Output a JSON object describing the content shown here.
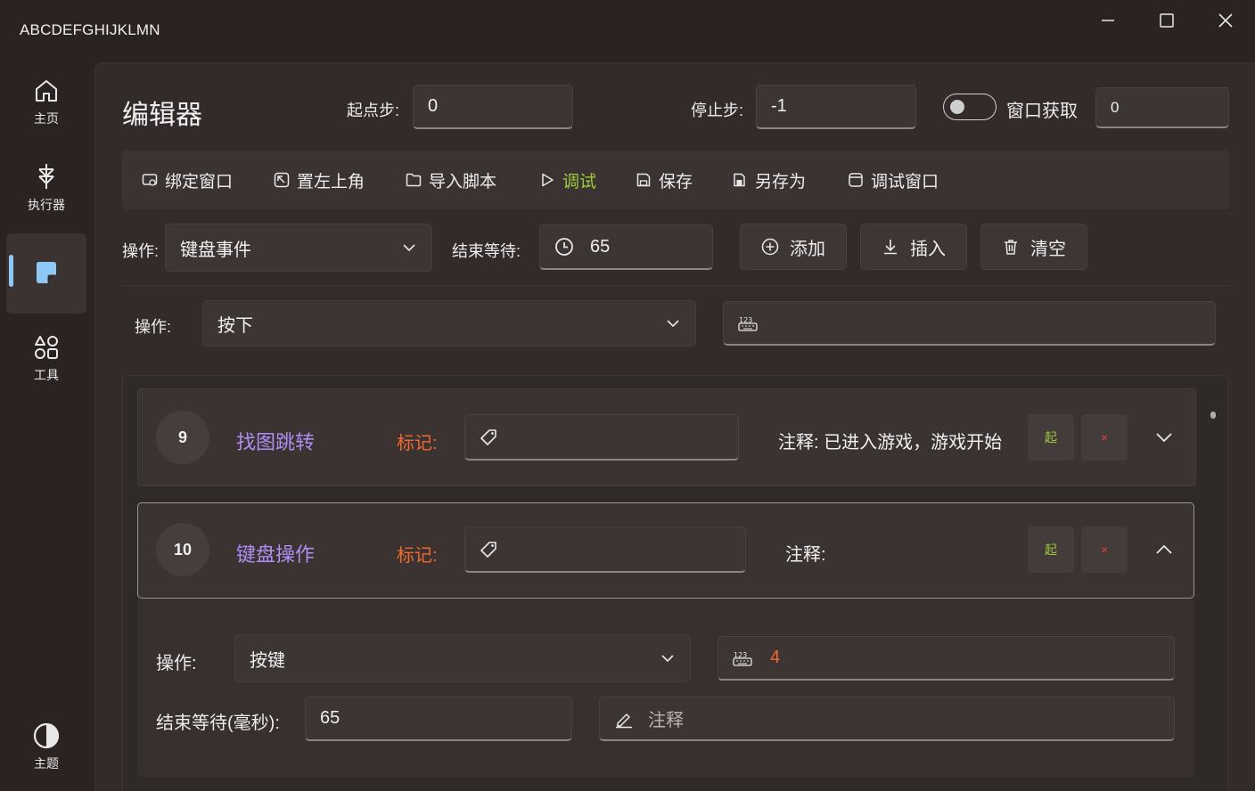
{
  "window": {
    "title": "ABCDEFGHIJKLMN"
  },
  "sidebar": {
    "items": [
      {
        "label": "主页",
        "icon": "home-icon"
      },
      {
        "label": "执行器",
        "icon": "executor-icon"
      },
      {
        "label": "",
        "icon": "editor-icon",
        "active": true
      },
      {
        "label": "工具",
        "icon": "tools-icon"
      }
    ],
    "bottom": {
      "label": "主题",
      "icon": "theme-icon"
    }
  },
  "header": {
    "title": "编辑器",
    "start_step_label": "起点步:",
    "start_step_value": "0",
    "stop_step_label": "停止步:",
    "stop_step_value": "-1",
    "window_fetch_label": "窗口获取",
    "window_fetch_value": "0"
  },
  "toolbar": {
    "bind_window": "绑定窗口",
    "set_top_left": "置左上角",
    "import_script": "导入脚本",
    "debug": "调试",
    "save": "保存",
    "save_as": "另存为",
    "debug_window": "调试窗口"
  },
  "action_row": {
    "op_label": "操作:",
    "op_value": "键盘事件",
    "wait_label": "结束等待:",
    "wait_value": "65",
    "add": "添加",
    "insert": "插入",
    "clear": "清空"
  },
  "sub_action": {
    "op_label": "操作:",
    "op_value": "按下",
    "key_value": ""
  },
  "steps": [
    {
      "number": "9",
      "title": "找图跳转",
      "mark_label": "标记:",
      "mark_value": "",
      "note": "注释: 已进入游戏，游戏开始",
      "start_btn": "起",
      "delete_btn": "×"
    },
    {
      "number": "10",
      "title": "键盘操作",
      "mark_label": "标记:",
      "mark_value": "",
      "note": "注释:",
      "start_btn": "起",
      "delete_btn": "×"
    }
  ],
  "detail": {
    "op_label": "操作:",
    "op_value": "按键",
    "key_value": "4",
    "wait_label": "结束等待(毫秒):",
    "wait_value": "65",
    "note_placeholder": "注释"
  },
  "colors": {
    "accent_blue": "#8ec8f5",
    "debug_green": "#9ccc3a",
    "title_purple": "#b28cf0",
    "mark_orange": "#f06a2e",
    "delete_red": "#e0403a"
  }
}
